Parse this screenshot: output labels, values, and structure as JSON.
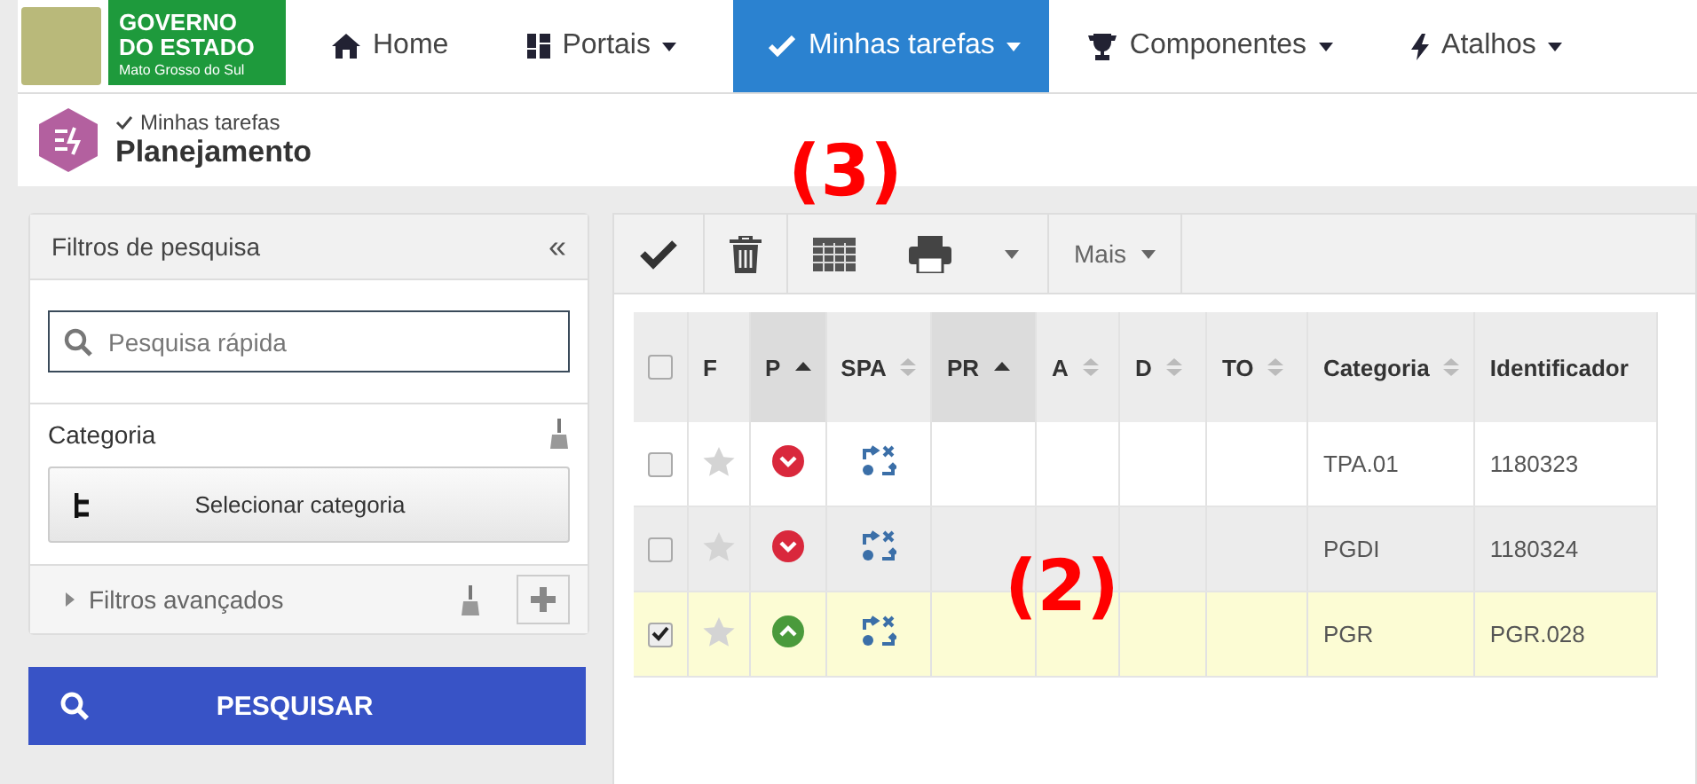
{
  "brand": {
    "line_1": "GOVERNO",
    "line_2": "DO ESTADO",
    "line_3": "Mato Grosso do Sul"
  },
  "nav": [
    {
      "label": "Home",
      "kind": "home",
      "caret": false,
      "selected": false
    },
    {
      "label": "Portais",
      "kind": "grid",
      "caret": true,
      "selected": false
    },
    {
      "label": "Minhas tarefas",
      "kind": "check",
      "caret": true,
      "selected": true
    },
    {
      "label": "Componentes",
      "kind": "trophy",
      "caret": true,
      "selected": false
    },
    {
      "label": "Atalhos",
      "kind": "bolt",
      "caret": true,
      "selected": false
    }
  ],
  "breadcrumb": {
    "parent": "Minhas tarefas",
    "title": "Planejamento"
  },
  "filters": {
    "title": "Filtros de pesquisa",
    "collapse": "«",
    "search_placeholder": "Pesquisa rápida",
    "category_label": "Categoria",
    "category_button": "Selecionar categoria",
    "advanced_label": "Filtros avançados",
    "advanced_expanded": false,
    "search_button": "PESQUISAR"
  },
  "toolbar": {
    "more": "Mais"
  },
  "table": {
    "select_all_checked": false,
    "columns": [
      {
        "label": "F",
        "kind": "plain"
      },
      {
        "label": "P",
        "kind": "sorted"
      },
      {
        "label": "SPA",
        "kind": "sortable"
      },
      {
        "label": "PR",
        "kind": "sorted"
      },
      {
        "label": "A",
        "kind": "sortable"
      },
      {
        "label": "D",
        "kind": "sortable"
      },
      {
        "label": "TO",
        "kind": "sortable"
      },
      {
        "label": "Categoria",
        "kind": "sortable"
      },
      {
        "label": "Identificador",
        "kind": "plain"
      }
    ],
    "rows": [
      {
        "checked": false,
        "starred": false,
        "priority_high": false,
        "category": "TPA.01",
        "identifier": "1180323"
      },
      {
        "checked": false,
        "starred": false,
        "priority_high": false,
        "category": "PGDI",
        "identifier": "1180324"
      },
      {
        "checked": true,
        "starred": false,
        "priority_high": true,
        "category": "PGR",
        "identifier": "PGR.028"
      }
    ]
  },
  "annotations": [
    {
      "label": "(3)"
    },
    {
      "label": "(2)"
    }
  ]
}
